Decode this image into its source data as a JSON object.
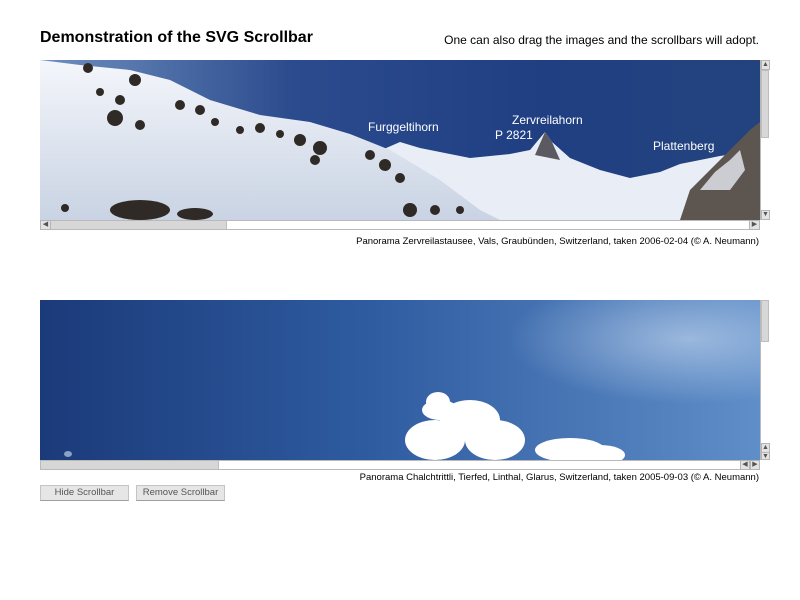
{
  "page": {
    "title": "Demonstration of the SVG Scrollbar",
    "hint": "One can also drag the images and the scrollbars will adopt."
  },
  "panorama1": {
    "labels": {
      "furggeltihorn": "Furggeltihorn",
      "zervreilahorn": "Zervreilahorn",
      "p2821": "P 2821",
      "plattenberg": "Plattenberg"
    },
    "caption": "Panorama Zervreilastausee, Vals, Graubünden, Switzerland, taken 2006-02-04 (© A. Neumann)",
    "h_scroll_position": 0.0,
    "v_scroll_position": 0.0
  },
  "panorama2": {
    "caption": "Panorama Chalchtrittli, Tierfed, Linthal, Glarus, Switzerland, taken 2005-09-03 (© A. Neumann)",
    "h_scroll_position": 0.0,
    "v_scroll_position": 0.0
  },
  "buttons": {
    "hide": "Hide Scrollbar",
    "remove": "Remove Scrollbar"
  },
  "icons": {
    "arrow_up": "▲",
    "arrow_down": "▼",
    "arrow_left": "◀",
    "arrow_right": "▶"
  },
  "colors": {
    "sky_dark": "#1c3a78",
    "sky_light": "#5f89c6",
    "snow": "#eef2f8",
    "scrollbar_thumb": "#d7d7d7",
    "button_bg": "#e6e6e6"
  }
}
